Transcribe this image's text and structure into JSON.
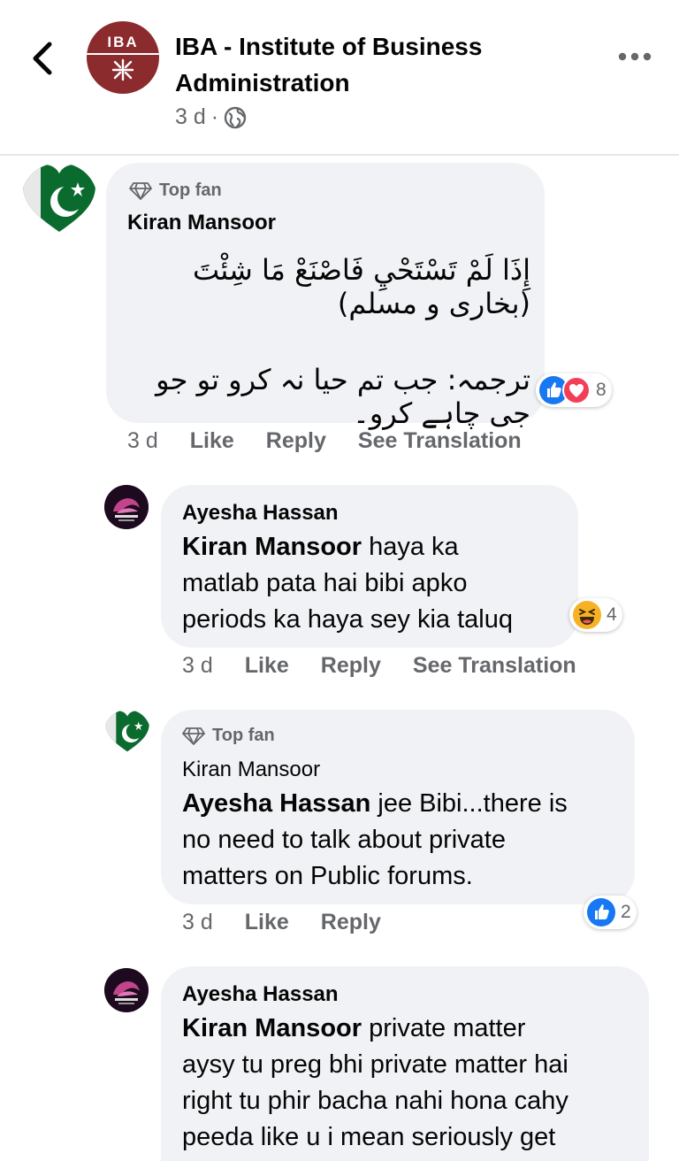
{
  "header": {
    "page_name": "IBA - Institute of Business Administration",
    "logo_text": "IBA",
    "post_time": "3 d",
    "separator": "·"
  },
  "comments": [
    {
      "badge": "Top fan",
      "author": "Kiran Mansoor",
      "urdu_line1": "إِذَا لَمْ تَسْتَحْيِ فَاصْنَعْ مَا شِئْتَ (بخاری و مسلم)",
      "urdu_line2": "ترجمہ: جب تم حیا نہ کرو تو جو جی چاہے کرو۔",
      "reaction_count": "8",
      "time": "3 d",
      "like": "Like",
      "reply": "Reply",
      "translate": "See Translation"
    },
    {
      "author": "Ayesha Hassan",
      "mention": "Kiran Mansoor",
      "text_l1": " haya ka",
      "text_l2": "matlab pata hai bibi apko",
      "text_l3": "periods ka haya sey kia taluq",
      "reaction_count": "4",
      "time": "3 d",
      "like": "Like",
      "reply": "Reply",
      "translate": "See Translation"
    },
    {
      "badge": "Top fan",
      "author": "Kiran Mansoor",
      "mention": "Ayesha Hassan",
      "text_l1": " jee Bibi...there is",
      "text_l2": "no need to talk about private",
      "text_l3": "matters on Public forums.",
      "reaction_count": "2",
      "time": "3 d",
      "like": "Like",
      "reply": "Reply"
    },
    {
      "author": "Ayesha Hassan",
      "mention": "Kiran Mansoor",
      "text_l1": "  private matter",
      "text_l2": "aysy tu preg bhi private matter hai",
      "text_l3": "right tu phir bacha nahi hona cahy",
      "text_l4": "peeda like u i mean seriously get"
    }
  ],
  "colors": {
    "bubble": "#f0f2f5",
    "secondary_text": "#65676b",
    "like_blue": "#1877f2",
    "love_red": "#f33e58",
    "haha_yellow": "#f7b125",
    "iba_maroon": "#8c2b2e"
  },
  "icons": [
    "back-arrow-icon",
    "globe-icon",
    "more-dots-icon",
    "diamond-icon",
    "like-reaction-icon",
    "love-reaction-icon",
    "haha-reaction-icon"
  ]
}
